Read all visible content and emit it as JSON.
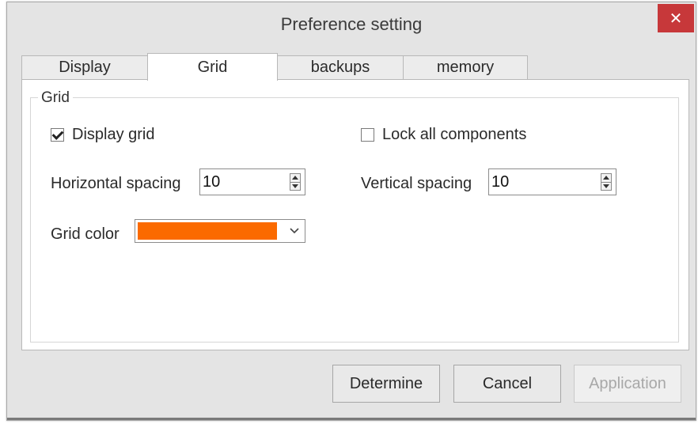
{
  "window": {
    "title": "Preference setting",
    "close_icon": "close-icon"
  },
  "tabs": [
    {
      "label": "Display",
      "active": false
    },
    {
      "label": "Grid",
      "active": true
    },
    {
      "label": "backups",
      "active": false
    },
    {
      "label": "memory",
      "active": false
    }
  ],
  "grid_group": {
    "title": "Grid",
    "display_grid": {
      "label": "Display grid",
      "checked": true
    },
    "lock_components": {
      "label": "Lock all components",
      "checked": false
    },
    "horizontal_spacing": {
      "label": "Horizontal spacing",
      "value": "10"
    },
    "vertical_spacing": {
      "label": "Vertical spacing",
      "value": "10"
    },
    "grid_color": {
      "label": "Grid color",
      "value": "#fb6a00"
    }
  },
  "buttons": {
    "determine": "Determine",
    "cancel": "Cancel",
    "application": "Application"
  },
  "colors": {
    "close_bg": "#c7383a",
    "window_bg": "#e4e4e4",
    "grid_swatch": "#fb6a00"
  }
}
